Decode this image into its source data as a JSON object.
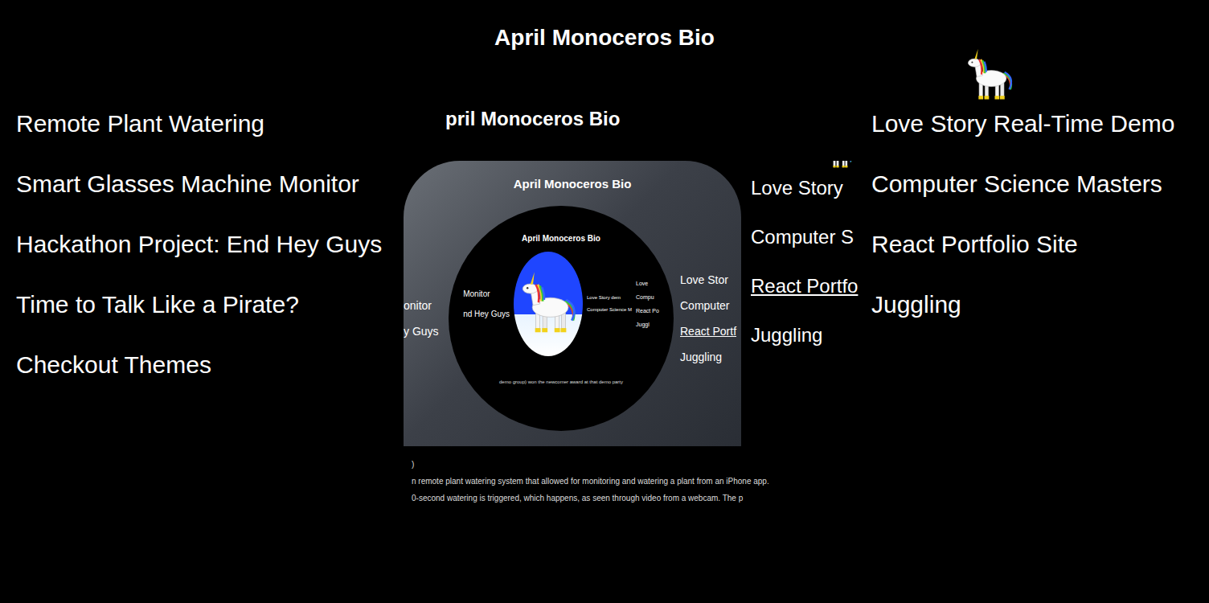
{
  "page": {
    "title": "April Monoceros Bio"
  },
  "left_links": [
    "Remote Plant Watering",
    "Smart Glasses Machine Monitor",
    "Hackathon Project: End Hey Guys",
    "Time to Talk Like a Pirate?",
    "Checkout Themes"
  ],
  "right_links": [
    "Love Story Real-Time Demo",
    "Computer Science Masters",
    "React Portfolio Site",
    "Juggling"
  ],
  "mirror": {
    "title": "pril Monoceros Bio",
    "right_links": [
      {
        "label": "Love Story",
        "hovered": false
      },
      {
        "label": "Computer S",
        "hovered": false
      },
      {
        "label": "React Portfo",
        "hovered": true
      },
      {
        "label": "Juggling",
        "hovered": false
      }
    ],
    "captions": [
      ")",
      "n remote plant watering system that allowed for monitoring and watering a plant from an iPhone app.",
      "0-second watering is triggered, which happens, as seen through video from a webcam. The p"
    ],
    "nested": {
      "title": "April Monoceros Bio",
      "left_links": [
        "onitor",
        "y Guys"
      ],
      "right_links": [
        {
          "label": "Love Stor",
          "hovered": false
        },
        {
          "label": "Computer",
          "hovered": false
        },
        {
          "label": "React Portf",
          "hovered": true
        },
        {
          "label": "Juggling",
          "hovered": false
        }
      ],
      "inner": {
        "title": "April Monoceros Bio",
        "left_links": [
          "Monitor",
          "nd Hey Guys"
        ],
        "mid_links": [
          "Love Story dem",
          "Computer Science M"
        ],
        "far_links": [
          "Love",
          "Compu",
          "React Po",
          "Juggl"
        ],
        "caption": "demo group) won the newcomer award at that demo party"
      }
    }
  }
}
